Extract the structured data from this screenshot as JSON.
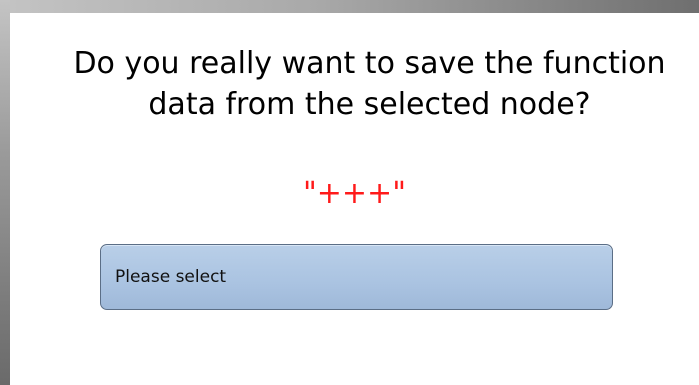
{
  "dialog": {
    "question": "Do you really want to save the function data from the selected node?",
    "node_name": "\"+++\"",
    "node_name_color": "#ff1a1a",
    "select": {
      "value": "Please select",
      "accent_color": "#aac3e1"
    }
  }
}
